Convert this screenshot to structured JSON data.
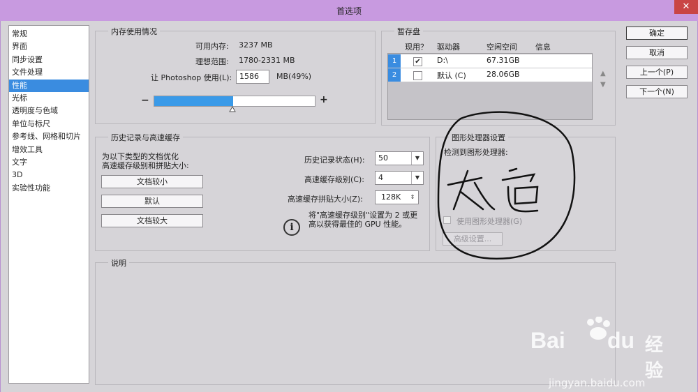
{
  "window": {
    "title": "首选项",
    "close_glyph": "✕"
  },
  "sidebar": {
    "items": [
      {
        "label": "常规"
      },
      {
        "label": "界面"
      },
      {
        "label": "同步设置"
      },
      {
        "label": "文件处理"
      },
      {
        "label": "性能",
        "active": true
      },
      {
        "label": "光标"
      },
      {
        "label": "透明度与色域"
      },
      {
        "label": "单位与标尺"
      },
      {
        "label": "参考线、网格和切片"
      },
      {
        "label": "增效工具"
      },
      {
        "label": "文字"
      },
      {
        "label": "3D"
      },
      {
        "label": "实验性功能"
      }
    ]
  },
  "memory": {
    "legend": "内存使用情况",
    "available_label": "可用内存:",
    "available_value": "3237 MB",
    "ideal_label": "理想范围:",
    "ideal_value": "1780-2331 MB",
    "let_label": "让 Photoshop 使用(L):",
    "input_value": "1586",
    "unit_label": "MB(49%)",
    "percent": 49,
    "minus": "−",
    "plus": "+"
  },
  "scratch": {
    "legend": "暂存盘",
    "headers": {
      "active": "现用？",
      "drive": "驱动器",
      "free": "空闲空间",
      "info": "信息"
    },
    "rows": [
      {
        "num": "1",
        "checked": "✔",
        "drive": "D:\\",
        "free": "67.31GB"
      },
      {
        "num": "2",
        "checked": "",
        "drive": "默认 (C)",
        "free": "28.06GB"
      }
    ],
    "up": "▲",
    "down": "▼"
  },
  "buttons": {
    "ok": "确定",
    "cancel": "取消",
    "prev": "上一个(P)",
    "next": "下一个(N)"
  },
  "history": {
    "legend": "历史记录与高速缓存",
    "optimize_line1": "为以下类型的文档优化",
    "optimize_line2": "高速缓存级别和拼贴大小:",
    "btn_small": "文档较小",
    "btn_default": "默认",
    "btn_large": "文档较大",
    "states_label": "历史记录状态(H):",
    "states_value": "50",
    "cache_levels_label": "高速缓存级别(C):",
    "cache_levels_value": "4",
    "tile_label": "高速缓存拼贴大小(Z):",
    "tile_value": "128K",
    "note_line1": "将\"高速缓存级别\"设置为 2 或更",
    "note_line2": "高以获得最佳的 GPU 性能。",
    "info_glyph": "i"
  },
  "gpu": {
    "legend": "图形处理器设置",
    "detected_label": "检测到图形处理器:",
    "use_label": "使用图形处理器(G)",
    "advanced": "高级设置..."
  },
  "description": {
    "legend": "说明"
  },
  "watermark": {
    "baidu": "Bai",
    "du": "du",
    "jingyan": "经验",
    "url": "jingyan.baidu.com"
  },
  "colors": {
    "accent": "#3a8ce0",
    "title_bar": "#c89ae0",
    "close": "#c94545"
  }
}
